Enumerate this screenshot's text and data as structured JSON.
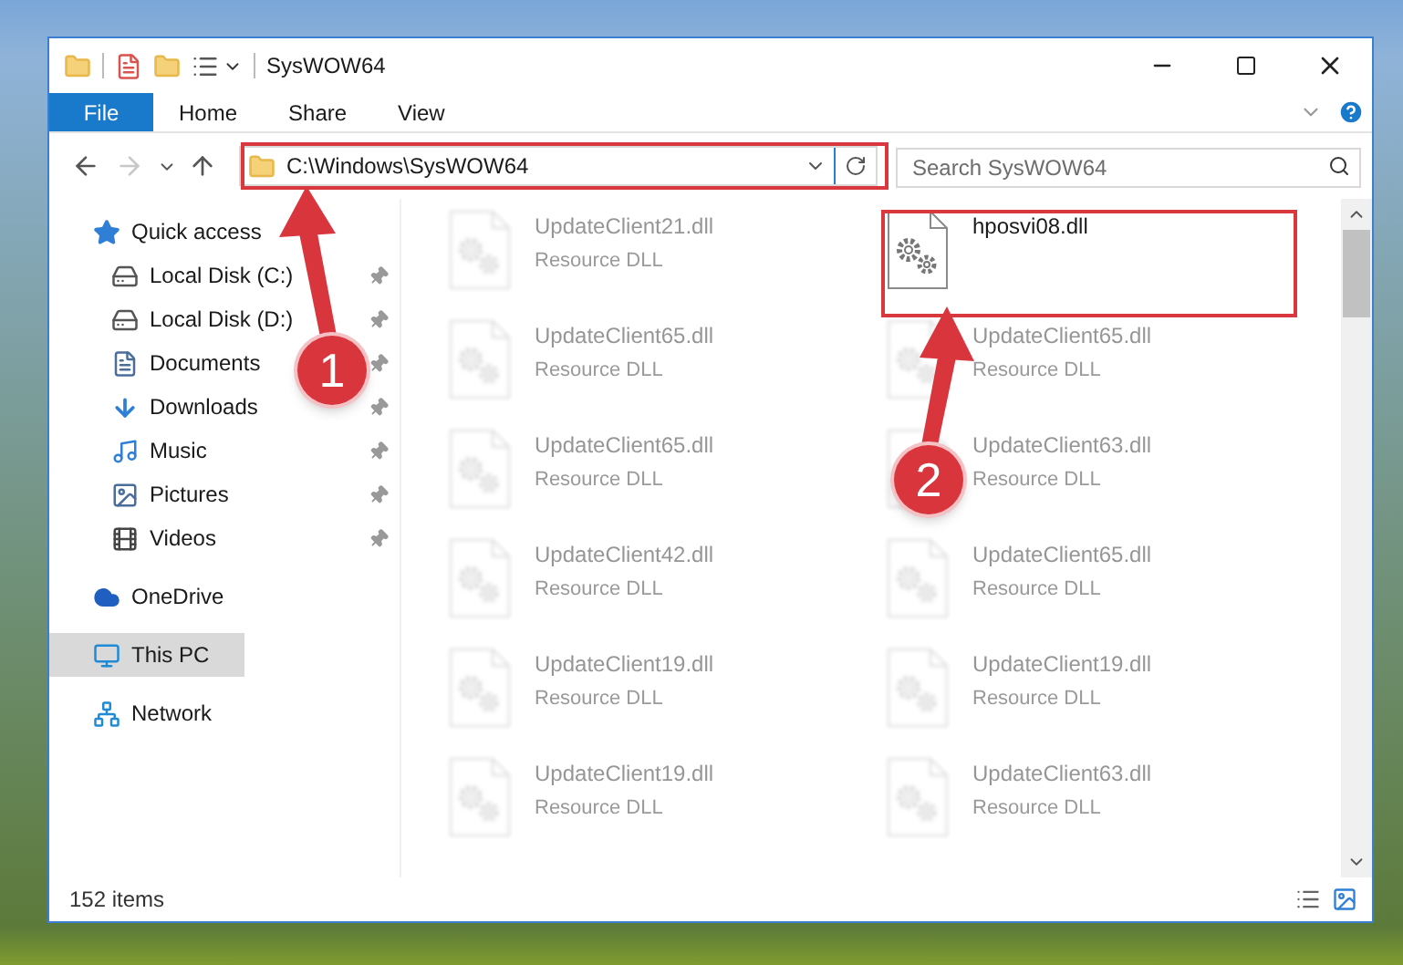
{
  "window": {
    "title": "SysWOW64"
  },
  "ribbon_tabs": [
    {
      "label": "File",
      "kind": "file"
    },
    {
      "label": "Home",
      "kind": "tab"
    },
    {
      "label": "Share",
      "kind": "tab"
    },
    {
      "label": "View",
      "kind": "tab"
    }
  ],
  "nav_buttons": [
    {
      "kind": "back",
      "disabled": false
    },
    {
      "kind": "forward",
      "disabled": true
    },
    {
      "kind": "recent",
      "disabled": false
    },
    {
      "kind": "up",
      "disabled": false
    }
  ],
  "address_bar": {
    "path": "C:\\Windows\\SysWOW64"
  },
  "search": {
    "placeholder": "Search SysWOW64"
  },
  "sidebar": {
    "items": [
      {
        "label": "Quick access",
        "kind": "star",
        "selected": false,
        "children": [
          {
            "label": "Local Disk (C:)",
            "kind": "drive",
            "pinned": true,
            "selected": false
          },
          {
            "label": "Local Disk (D:)",
            "kind": "drive",
            "pinned": true,
            "selected": false
          },
          {
            "label": "Documents",
            "kind": "documents",
            "pinned": true,
            "selected": false
          },
          {
            "label": "Downloads",
            "kind": "downloads",
            "pinned": true,
            "selected": false
          },
          {
            "label": "Music",
            "kind": "music",
            "pinned": true,
            "selected": false
          },
          {
            "label": "Pictures",
            "kind": "pictures",
            "pinned": true,
            "selected": false
          },
          {
            "label": "Videos",
            "kind": "videos",
            "pinned": true,
            "selected": false
          }
        ]
      },
      {
        "label": "OneDrive",
        "kind": "cloud",
        "selected": false
      },
      {
        "label": "This PC",
        "kind": "pc",
        "selected": true
      },
      {
        "label": "Network",
        "kind": "network",
        "selected": false
      }
    ]
  },
  "files": [
    {
      "name": "UpdateClient21.dll",
      "type": "Resource DLL",
      "blurred": true
    },
    {
      "name": "hposvi08.dll",
      "blurred": false
    },
    {
      "name": "UpdateClient65.dll",
      "type": "Resource DLL",
      "blurred": true
    },
    {
      "name": "UpdateClient65.dll",
      "type": "Resource DLL",
      "blurred": true
    },
    {
      "name": "UpdateClient65.dll",
      "type": "Resource DLL",
      "blurred": true
    },
    {
      "name": "UpdateClient63.dll",
      "type": "Resource DLL",
      "blurred": true
    },
    {
      "name": "UpdateClient42.dll",
      "type": "Resource DLL",
      "blurred": true
    },
    {
      "name": "UpdateClient65.dll",
      "type": "Resource DLL",
      "blurred": true
    },
    {
      "name": "UpdateClient19.dll",
      "type": "Resource DLL",
      "blurred": true
    },
    {
      "name": "UpdateClient19.dll",
      "type": "Resource DLL",
      "blurred": true
    },
    {
      "name": "UpdateClient19.dll",
      "type": "Resource DLL",
      "blurred": true
    },
    {
      "name": "UpdateClient63.dll",
      "type": "Resource DLL",
      "blurred": true
    }
  ],
  "status_bar": {
    "item_count": "152 items"
  },
  "annotations": [
    {
      "number": "1"
    },
    {
      "number": "2"
    }
  ]
}
